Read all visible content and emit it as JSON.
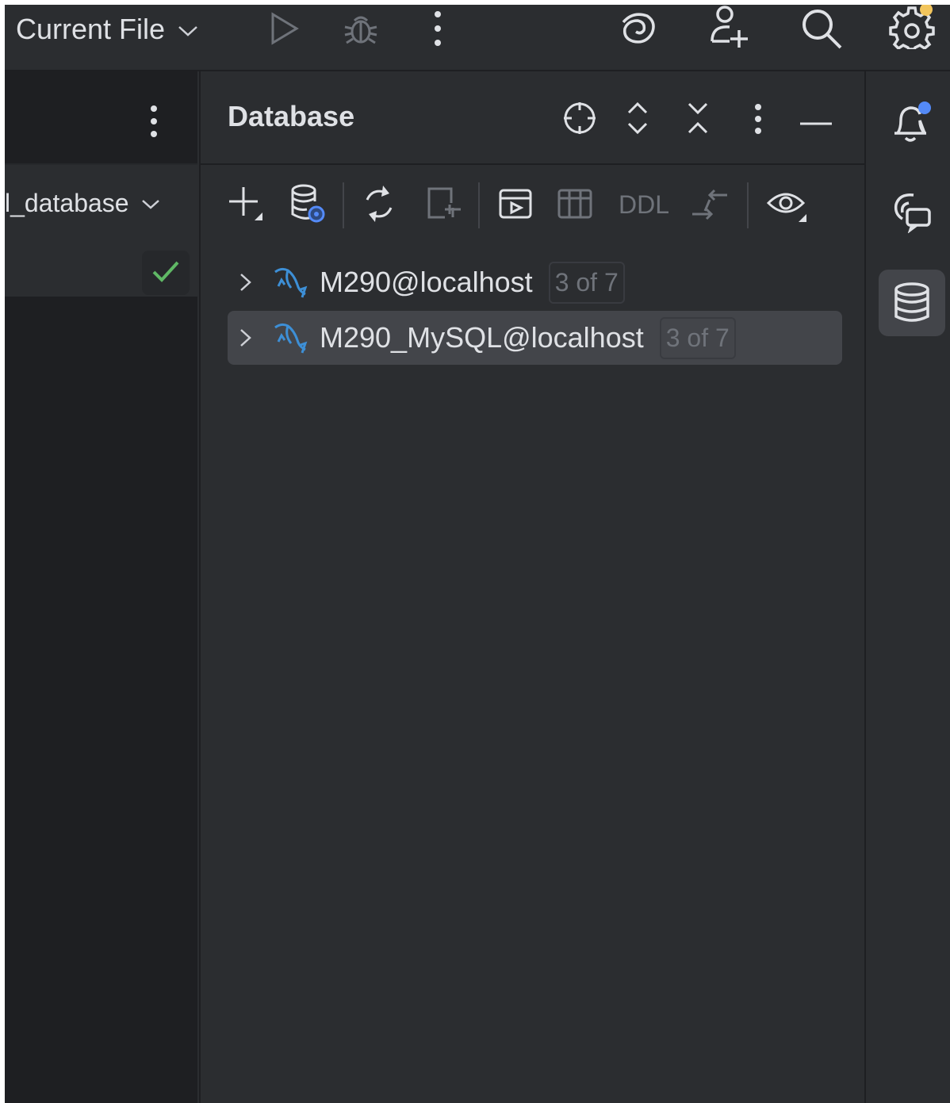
{
  "toolbar": {
    "run_config_label": "Current File",
    "icons": [
      "chevron-down-icon",
      "run-icon",
      "debug-icon",
      "more-vertical-icon",
      "ai-assistant-spiral-icon",
      "add-user-icon",
      "search-icon",
      "settings-gear-icon"
    ],
    "settings_badge_color": "#f2c55c"
  },
  "left_panel": {
    "schema_label": "l_database",
    "status": "check-icon",
    "status_color": "#5fb865"
  },
  "database_panel": {
    "title": "Database",
    "header_icons": [
      "locate-target-icon",
      "expand-all-icon",
      "collapse-all-icon",
      "more-vertical-icon",
      "minimize-icon"
    ],
    "toolbar_icons": [
      "add-icon",
      "data-source-properties-icon",
      "refresh-icon",
      "disconnect-icon",
      "jump-to-query-console-icon",
      "table-icon",
      "ddl-label",
      "compare-icon",
      "view-options-icon"
    ],
    "ddl_label": "DDL",
    "connections": [
      {
        "name": "M290@localhost",
        "count": "3 of 7",
        "selected": false
      },
      {
        "name": "M290_MySQL@localhost",
        "count": "3 of 7",
        "selected": true
      }
    ]
  },
  "right_strip": {
    "icons": [
      "notifications-bell-icon",
      "ai-chat-icon",
      "database-icon"
    ],
    "notification_dot_color": "#548af7",
    "active": "database-icon"
  },
  "colors": {
    "background": "#2b2d30",
    "editor_background": "#1e1f22",
    "selection": "#43454a",
    "text": "#dfe1e5",
    "muted_text": "#6f737a",
    "mysql_blue": "#3d8fd6"
  }
}
